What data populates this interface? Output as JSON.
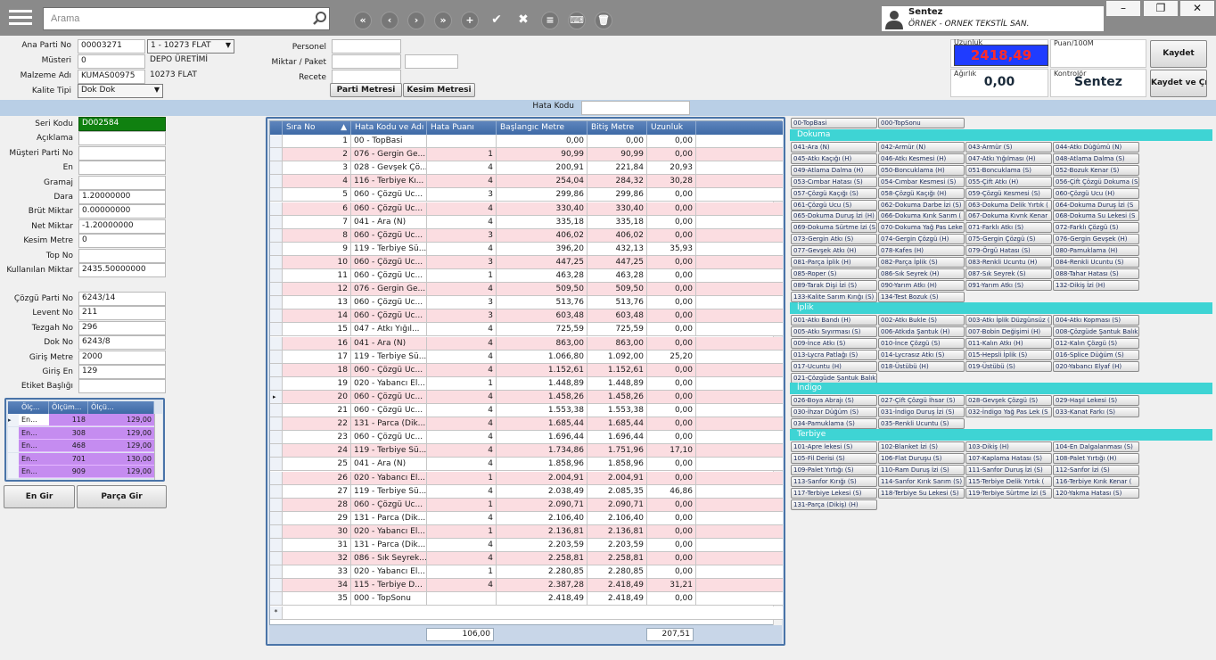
{
  "search": {
    "placeholder": "Arama"
  },
  "user": {
    "name": "Sentez",
    "company": "ÖRNEK - ORNEK TEKSTİL SAN."
  },
  "toolbar": {
    "icons": [
      "first-icon",
      "prev-icon",
      "next-icon",
      "last-icon",
      "add-icon",
      "check-icon",
      "cancel-icon",
      "list-icon",
      "keyboard-icon",
      "delete-icon"
    ]
  },
  "header": {
    "ana_parti_label": "Ana Parti No",
    "ana_parti_value": "00003271",
    "ana_parti_combo": "1 - 10273 FLAT",
    "musteri_label": "Müsteri",
    "musteri_value": "0",
    "musteri_name": "DEPO ÜRETİMİ",
    "malzeme_label": "Malzeme Adı",
    "malzeme_value": "KUMAS00975",
    "malzeme_name": "10273 FLAT",
    "kalite_label": "Kalite Tipi",
    "kalite_value": "Dok Dok",
    "personel_label": "Personel",
    "miktar_label": "Miktar / Paket",
    "recete_label": "Recete",
    "parti_metresi": "Parti Metresi",
    "kesim_metresi": "Kesim Metresi",
    "uzunluk_label": "Uzunluk",
    "uzunluk_value": "2418,49",
    "puan_label": "Puan/100M",
    "agirlik_label": "Ağırlık",
    "agirlik_value": "0,00",
    "kontrolor_label": "Kontrolör",
    "kontrolor_value": "Sentez",
    "kaydet": "Kaydet",
    "kaydet_cik": "Kaydet ve Çık",
    "hata_kodu_label": "Hata Kodu"
  },
  "form": [
    {
      "label": "Seri Kodu",
      "value": "D002584"
    },
    {
      "label": "Açıklama",
      "value": ""
    },
    {
      "label": "Müşteri Parti No",
      "value": ""
    },
    {
      "label": "En",
      "value": ""
    },
    {
      "label": "Gramaj",
      "value": ""
    },
    {
      "label": "Dara",
      "value": "1.20000000"
    },
    {
      "label": "Brüt Miktar",
      "value": "0.00000000"
    },
    {
      "label": "Net Miktar",
      "value": "-1.20000000"
    },
    {
      "label": "Kesim Metre",
      "value": "0"
    },
    {
      "label": "Top No",
      "value": ""
    },
    {
      "label": "Kullanılan Miktar",
      "value": "2435.50000000"
    }
  ],
  "form2": [
    {
      "label": "Çözgü Parti No",
      "value": "6243/14"
    },
    {
      "label": "Levent No",
      "value": "211"
    },
    {
      "label": "Tezgah No",
      "value": "296"
    },
    {
      "label": "Dok No",
      "value": "6243/8"
    },
    {
      "label": "Giriş Metre",
      "value": "2000"
    },
    {
      "label": "Giriş En",
      "value": "129"
    },
    {
      "label": "Etiket Başlığı",
      "value": ""
    }
  ],
  "small_grid": {
    "headers": [
      "Ölç...",
      "Ölçüm...",
      "Ölçü..."
    ],
    "rows": [
      [
        "En...",
        "118",
        "129,00"
      ],
      [
        "En...",
        "308",
        "129,00"
      ],
      [
        "En...",
        "468",
        "129,00"
      ],
      [
        "En...",
        "701",
        "130,00"
      ],
      [
        "En...",
        "909",
        "129,00"
      ]
    ]
  },
  "en_gir": "En Gir",
  "parca_gir": "Parça Gir",
  "grid": {
    "headers": [
      "Sıra No",
      "Hata Kodu ve Adı",
      "Hata Puanı",
      "Başlangıc Metre",
      "Bitiş Metre",
      "Uzunluk"
    ],
    "rows": [
      [
        "1",
        "00 - TopBasi",
        "",
        "0,00",
        "0,00",
        "0,00"
      ],
      [
        "2",
        "076 - Gergin Ge...",
        "1",
        "90,99",
        "90,99",
        "0,00"
      ],
      [
        "3",
        "028 - Gevşek Çö...",
        "4",
        "200,91",
        "221,84",
        "20,93"
      ],
      [
        "4",
        "116 - Terbiye Kı...",
        "4",
        "254,04",
        "284,32",
        "30,28"
      ],
      [
        "5",
        "060 - Çözgü Uc...",
        "3",
        "299,86",
        "299,86",
        "0,00"
      ],
      [
        "6",
        "060 - Çözgü Uc...",
        "4",
        "330,40",
        "330,40",
        "0,00"
      ],
      [
        "7",
        "041 - Ara (N)",
        "4",
        "335,18",
        "335,18",
        "0,00"
      ],
      [
        "8",
        "060 - Çözgü Uc...",
        "3",
        "406,02",
        "406,02",
        "0,00"
      ],
      [
        "9",
        "119 - Terbiye Sü...",
        "4",
        "396,20",
        "432,13",
        "35,93"
      ],
      [
        "10",
        "060 - Çözgü Uc...",
        "3",
        "447,25",
        "447,25",
        "0,00"
      ],
      [
        "11",
        "060 - Çözgü Uc...",
        "1",
        "463,28",
        "463,28",
        "0,00"
      ],
      [
        "12",
        "076 - Gergin Ge...",
        "4",
        "509,50",
        "509,50",
        "0,00"
      ],
      [
        "13",
        "060 - Çözgü Uc...",
        "3",
        "513,76",
        "513,76",
        "0,00"
      ],
      [
        "14",
        "060 - Çözgü Uc...",
        "3",
        "603,48",
        "603,48",
        "0,00"
      ],
      [
        "15",
        "047 - Atkı Yığıl...",
        "4",
        "725,59",
        "725,59",
        "0,00"
      ],
      [
        "16",
        "041 - Ara (N)",
        "4",
        "863,00",
        "863,00",
        "0,00"
      ],
      [
        "17",
        "119 - Terbiye Sü...",
        "4",
        "1.066,80",
        "1.092,00",
        "25,20"
      ],
      [
        "18",
        "060 - Çözgü Uc...",
        "4",
        "1.152,61",
        "1.152,61",
        "0,00"
      ],
      [
        "19",
        "020 - Yabancı El...",
        "1",
        "1.448,89",
        "1.448,89",
        "0,00"
      ],
      [
        "20",
        "060 - Çözgü Uc...",
        "4",
        "1.458,26",
        "1.458,26",
        "0,00"
      ],
      [
        "21",
        "060 - Çözgü Uc...",
        "4",
        "1.553,38",
        "1.553,38",
        "0,00"
      ],
      [
        "22",
        "131 - Parca (Dik...",
        "4",
        "1.685,44",
        "1.685,44",
        "0,00"
      ],
      [
        "23",
        "060 - Çözgü Uc...",
        "4",
        "1.696,44",
        "1.696,44",
        "0,00"
      ],
      [
        "24",
        "119 - Terbiye Sü...",
        "4",
        "1.734,86",
        "1.751,96",
        "17,10"
      ],
      [
        "25",
        "041 - Ara (N)",
        "4",
        "1.858,96",
        "1.858,96",
        "0,00"
      ],
      [
        "26",
        "020 - Yabancı El...",
        "1",
        "2.004,91",
        "2.004,91",
        "0,00"
      ],
      [
        "27",
        "119 - Terbiye Sü...",
        "4",
        "2.038,49",
        "2.085,35",
        "46,86"
      ],
      [
        "28",
        "060 - Çözgü Uc...",
        "1",
        "2.090,71",
        "2.090,71",
        "0,00"
      ],
      [
        "29",
        "131 - Parca (Dik...",
        "4",
        "2.106,40",
        "2.106,40",
        "0,00"
      ],
      [
        "30",
        "020 - Yabancı El...",
        "1",
        "2.136,81",
        "2.136,81",
        "0,00"
      ],
      [
        "31",
        "131 - Parca (Dik...",
        "4",
        "2.203,59",
        "2.203,59",
        "0,00"
      ],
      [
        "32",
        "086 - Sık Seyrek...",
        "4",
        "2.258,81",
        "2.258,81",
        "0,00"
      ],
      [
        "33",
        "020 - Yabancı El...",
        "1",
        "2.280,85",
        "2.280,85",
        "0,00"
      ],
      [
        "34",
        "115 - Terbiye D...",
        "4",
        "2.387,28",
        "2.418,49",
        "31,21"
      ],
      [
        "35",
        "000 - TopSonu",
        "",
        "2.418,49",
        "2.418,49",
        "0,00"
      ]
    ],
    "footer_puan": "106,00",
    "footer_uzunluk": "207,51"
  },
  "defects": {
    "top": [
      "00-TopBasi",
      "000-TopSonu"
    ],
    "categories": [
      {
        "name": "Dokuma",
        "items": [
          "041-Ara (N)",
          "042-Armür (N)",
          "043-Armür (S)",
          "044-Atkı Düğümü (N)",
          "045-Atkı Kaçığı (H)",
          "046-Atkı Kesmesi (H)",
          "047-Atkı Yığılması (H)",
          "048-Atlama Dalma (S)",
          "049-Atlama Dalma (H)",
          "050-Boncuklama (H)",
          "051-Boncuklama (S)",
          "052-Bozuk Kenar (S)",
          "053-Cımbar Hatası (S)",
          "054-Cımbar Kesmesi (S)",
          "055-Çift Atkı (H)",
          "056-Çift Çözgü Dokuma (S",
          "057-Çözgü Kaçığı (S)",
          "058-Çözgü Kaçığı (H)",
          "059-Çözgü Kesmesi (S)",
          "060-Çözgü Ucu (H)",
          "061-Çözgü Ucu (S)",
          "062-Dokuma Darbe İzi (S)",
          "063-Dokuma Delik Yırtık (",
          "064-Dokuma Duruş İzi (S",
          "065-Dokuma Duruş İzi (H)",
          "066-Dokuma Kırık Sarım (",
          "067-Dokuma Kıvrık Kenar",
          "068-Dokuma Su Lekesi (S",
          "069-Dokuma Sürtme İzi (S",
          "070-Dokuma Yağ Pas Leke",
          "071-Farklı Atkı (S)",
          "072-Farklı Çözgü (S)",
          "073-Gergin Atkı (S)",
          "074-Gergin Çözgü (H)",
          "075-Gergin Çözgü (S)",
          "076-Gergin Gevşek (H)",
          "077-Gevşek Atkı (H)",
          "078-Kafes (H)",
          "079-Örgü Hatası (S)",
          "080-Pamuklama (H)",
          "081-Parça İplik (H)",
          "082-Parça İplik (S)",
          "083-Renkli Ucuntu (H)",
          "084-Renkli Ucuntu (S)",
          "085-Roper (S)",
          "086-Sık Seyrek (H)",
          "087-Sık Seyrek (S)",
          "088-Tahar Hatası (S)",
          "089-Tarak Dişi İzi (S)",
          "090-Yarım Atkı (H)",
          "091-Yarım Atkı (S)",
          "132-Dikiş İzi (H)",
          "133-Kalite Sarım Kırığı (S)",
          "134-Test Bozuk (S)"
        ]
      },
      {
        "name": "İplik",
        "items": [
          "001-Atkı Bandı (H)",
          "002-Atkı Bukle (S)",
          "003-Atkı İplik Düzgünsüz (",
          "004-Atkı Kopması (S)",
          "005-Atkı Sıyırması (S)",
          "006-Atkıda Şantuk (H)",
          "007-Bobin Değişimi (H)",
          "008-Çözgüde Şantuk Balık",
          "009-İnce Atkı (S)",
          "010-İnce Çözgü (S)",
          "011-Kalın Atkı (H)",
          "012-Kalın Çözgü (S)",
          "013-Lycra Patlağı (S)",
          "014-Lycrasız Atkı (S)",
          "015-Hepsli İplik (S)",
          "016-Splice Düğüm (S)",
          "017-Ucuntu (H)",
          "018-Üstübü (H)",
          "019-Üstübü (S)",
          "020-Yabancı Elyaf (H)",
          "021-Çözgüde Şantuk Balık"
        ]
      },
      {
        "name": "İndigo",
        "items": [
          "026-Boya Abrajı (S)",
          "027-Çift Çözgü İhsar (S)",
          "028-Gevşek Çözgü (S)",
          "029-Haşıl Lekesi (S)",
          "030-İhzar Düğüm (S)",
          "031-İndigo Duruş İzi (S)",
          "032-İndigo Yağ Pas Lek (S",
          "033-Kanat Farkı (S)",
          "034-Pamuklama (S)",
          "035-Renkli Ucuntu (S)"
        ]
      },
      {
        "name": "Terbiye",
        "items": [
          "101-Apre lekesi (S)",
          "102-Blanket İzi (S)",
          "103-Dikiş (H)",
          "104-En Dalgalanması (S)",
          "105-Fil Derisi (S)",
          "106-Flat Duruşu (S)",
          "107-Kaplama Hatası (S)",
          "108-Palet Yırtığı (H)",
          "109-Palet Yırtığı (S)",
          "110-Ram Duruş İzi (S)",
          "111-Sanfor Duruş İzi (S)",
          "112-Sanfor İzi (S)",
          "113-Sanfor Kırığı (S)",
          "114-Sanfor Kırık Sarım (S)",
          "115-Terbiye Delik Yırtık (",
          "116-Terbiye Kırık Kenar (",
          "117-Terbiye Lekesi (S)",
          "118-Terbiye Su Lekesi (S)",
          "119-Terbiye Sürtme İzi (S",
          "120-Yakma Hatası (S)",
          "131-Parça (Dikiş) (H)"
        ]
      }
    ]
  },
  "colors": {
    "accent": "#3ed4d4",
    "grid_header": "#4a74a8",
    "pink_row": "#fbdde1",
    "seri_green": "#108010",
    "uzunluk_bg": "#1f3cff",
    "uzunluk_fg": "#ff2b2b"
  }
}
